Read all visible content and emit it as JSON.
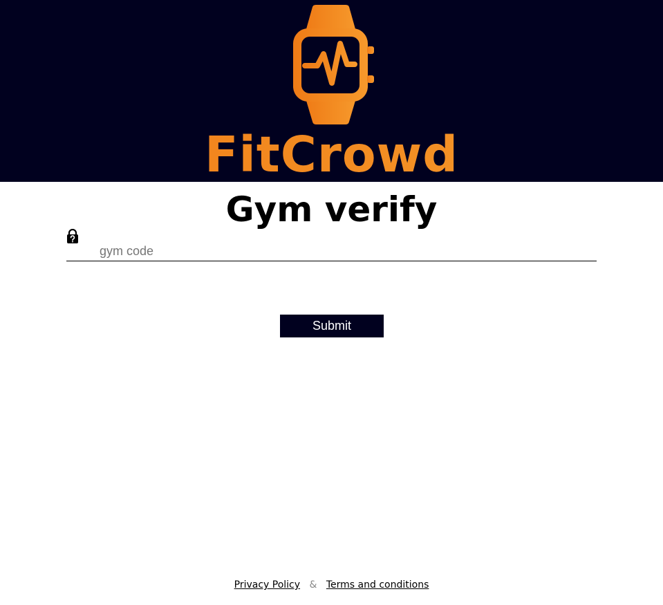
{
  "brand": {
    "name": "FitCrowd",
    "logo_icon": "smartwatch-heartbeat-icon",
    "color": "#f5861f",
    "header_bg": "#01011f"
  },
  "page": {
    "title": "Gym verify"
  },
  "form": {
    "field_icon": "lock-question-icon",
    "code_placeholder": "gym code",
    "code_value": "",
    "submit_label": "Submit"
  },
  "footer": {
    "privacy_label": "Privacy Policy",
    "separator": "&",
    "terms_label": "Terms and conditions"
  }
}
